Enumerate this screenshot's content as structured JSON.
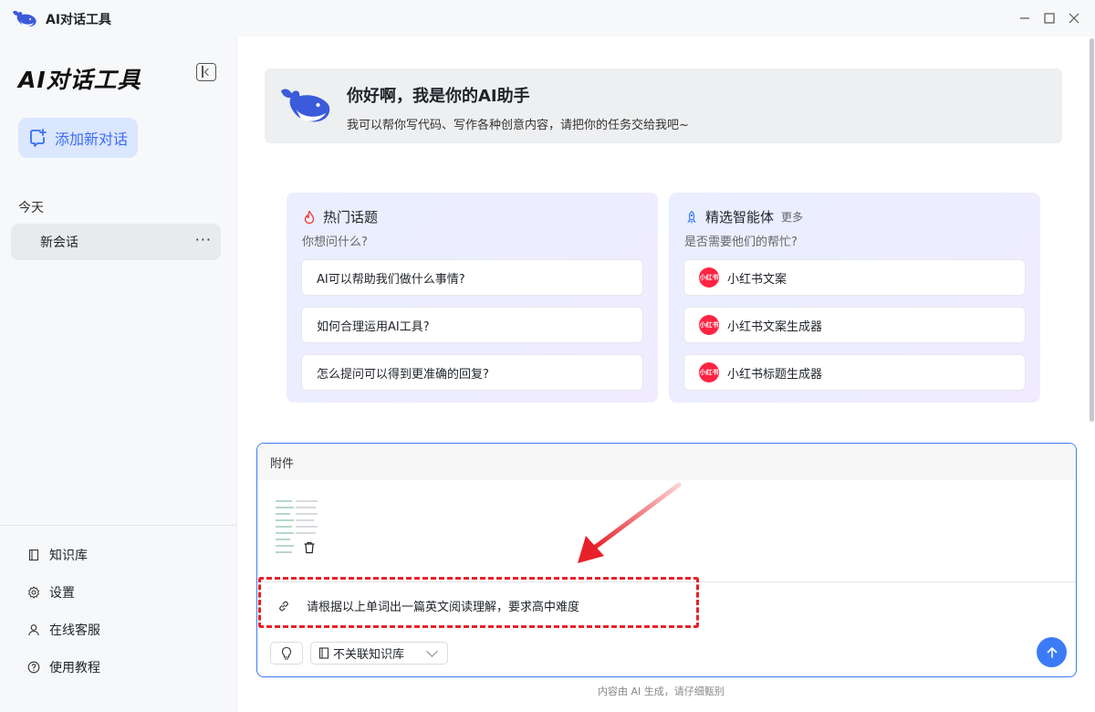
{
  "window": {
    "title": "AI对话工具",
    "controls": [
      "minimize",
      "maximize",
      "close"
    ]
  },
  "sidebar": {
    "title": "AI对话工具",
    "new_chat_label": "添加新对话",
    "section_label": "今天",
    "conversations": [
      {
        "label": "新会话",
        "more": "···"
      }
    ],
    "menu": [
      {
        "label": "知识库",
        "icon": "book-icon"
      },
      {
        "label": "设置",
        "icon": "gear-icon"
      },
      {
        "label": "在线客服",
        "icon": "user-icon"
      },
      {
        "label": "使用教程",
        "icon": "help-icon"
      }
    ]
  },
  "greeting": {
    "title": "你好啊，我是你的AI助手",
    "subtitle": "我可以帮你写代码、写作各种创意内容，请把你的任务交给我吧~"
  },
  "hot_topics": {
    "title": "热门话题",
    "subtitle": "你想问什么?",
    "items": [
      "AI可以帮助我们做什么事情?",
      "如何合理运用AI工具?",
      "怎么提问可以得到更准确的回复?"
    ]
  },
  "agents": {
    "title": "精选智能体",
    "more_label": "更多",
    "subtitle": "是否需要他们的帮忙?",
    "badge_text": "小红书",
    "items": [
      "小红书文案",
      "小红书文案生成器",
      "小红书标题生成器"
    ]
  },
  "composer": {
    "attachments_label": "附件",
    "prompt_text": "请根据以上单词出一篇英文阅读理解，要求高中难度",
    "knowledge_select_label": "不关联知识库"
  },
  "footer_note": "内容由 AI 生成，请仔细甄别",
  "colors": {
    "accent": "#3b7cf6",
    "annotation": "#e8202a",
    "badge": "#ff2442"
  }
}
